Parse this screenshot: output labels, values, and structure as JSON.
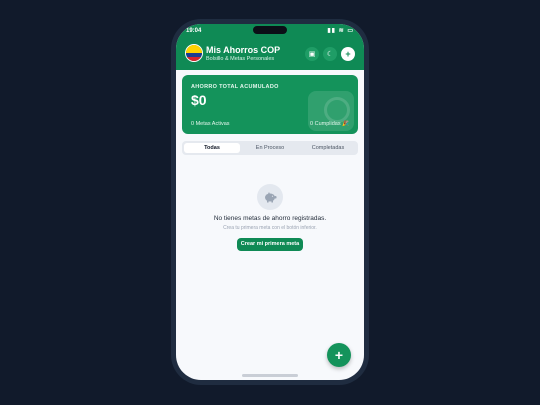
{
  "status_bar": {
    "time": "19:04",
    "icons": "▮▮ ≋ ▭"
  },
  "header": {
    "title": "Mis Ahorros COP",
    "subtitle": "Bolsillo & Metas Personales",
    "flag": "colombia-flag",
    "buttons": {
      "export_icon": "▣",
      "theme_icon": "☾",
      "add_icon": "+"
    }
  },
  "summary_card": {
    "label": "AHORRO TOTAL ACUMULADO",
    "amount": "$0",
    "active_goals": "0 Metas Activas",
    "completed_goals": "0 Cumplidas 🎉"
  },
  "tabs": [
    {
      "label": "Todas",
      "selected": true
    },
    {
      "label": "En Proceso",
      "selected": false
    },
    {
      "label": "Completadas",
      "selected": false
    }
  ],
  "empty_state": {
    "icon": "piggy-bank-icon",
    "title": "No tienes metas de ahorro registradas.",
    "subtitle": "Crea tu primera meta con el botón inferior.",
    "button_label": "Crear mi primera meta"
  },
  "fab": {
    "icon": "+"
  },
  "colors": {
    "brand": "#0f8a55",
    "card": "#14935b",
    "background": "#111a2b"
  }
}
